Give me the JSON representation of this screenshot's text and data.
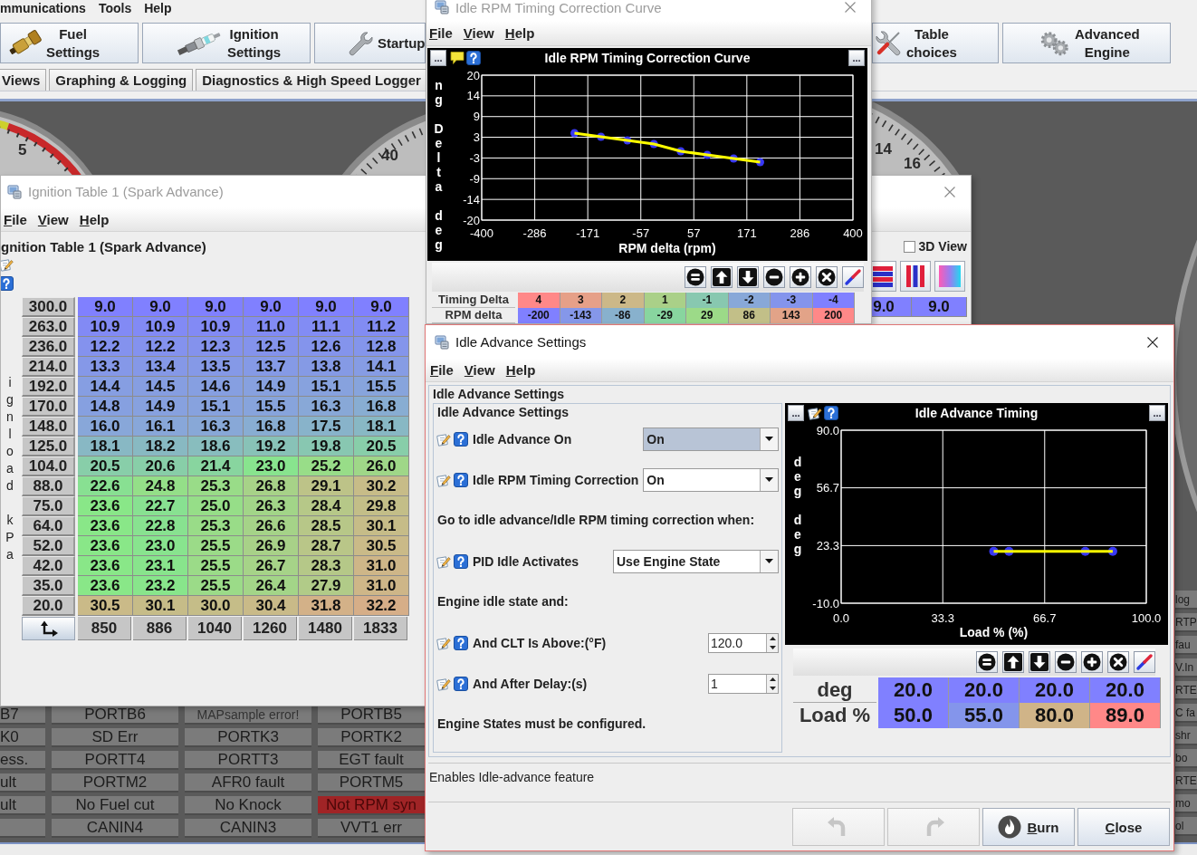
{
  "main_window": {
    "menu": [
      "mmunications",
      "Tools",
      "Help"
    ],
    "toolbar_left": [
      {
        "lines": [
          "Fuel",
          "Settings"
        ]
      },
      {
        "lines": [
          "Ignition",
          "Settings"
        ]
      },
      {
        "lines": [
          "Startup"
        ]
      }
    ],
    "toolbar_right": [
      {
        "lines": [
          "Table",
          "choices"
        ]
      },
      {
        "lines": [
          "Advanced",
          "Engine"
        ]
      }
    ],
    "tabs": [
      {
        "label": "Views",
        "selected": false
      },
      {
        "label": "Graphing & Logging",
        "selected": false
      },
      {
        "label": "Diagnostics & High Speed Logger",
        "selected": false
      }
    ],
    "dashboard": {
      "gauge_labels": [
        "5",
        "40",
        "14",
        "16"
      ],
      "indicator_columns": [
        [
          {
            "label": "B7",
            "on": false
          },
          {
            "label": "K0",
            "on": false
          },
          {
            "label": "ess.",
            "on": false
          },
          {
            "label": "ult",
            "on": false
          },
          {
            "label": "ult",
            "on": false
          },
          {
            "on": false
          }
        ],
        [
          {
            "label": "PORTB6",
            "on": false
          },
          {
            "label": "SD Err",
            "on": false
          },
          {
            "label": "PORTT4",
            "on": false
          },
          {
            "label": "PORTM2",
            "on": false
          },
          {
            "label": "No Fuel cut",
            "on": false
          },
          {
            "label": "CANIN4",
            "on": false
          }
        ],
        [
          {
            "label": "MAPsample error!",
            "on": false
          },
          {
            "label": "PORTK3",
            "on": false
          },
          {
            "label": "PORTT3",
            "on": false
          },
          {
            "label": "AFR0 fault",
            "on": false
          },
          {
            "label": "No Knock",
            "on": false
          },
          {
            "label": "CANIN3",
            "on": false
          }
        ],
        [
          {
            "label": "PORTB5",
            "on": false
          },
          {
            "label": "PORTK2",
            "on": false
          },
          {
            "label": "EGT fault",
            "on": false
          },
          {
            "label": "PORTM5",
            "on": false
          },
          {
            "label": "Not RPM syn",
            "on": true
          },
          {
            "label": "VVT1 err",
            "on": false
          }
        ]
      ],
      "edge_indicators": [
        {
          "label": "log",
          "on": false
        },
        {
          "label": "RTP",
          "on": false
        },
        {
          "label": "fau",
          "on": false
        },
        {
          "label": "V.In",
          "on": false
        },
        {
          "label": "RTE",
          "on": false
        },
        {
          "label": "C fa",
          "on": false
        },
        {
          "label": "shr",
          "on": false
        },
        {
          "label": "bo",
          "on": false
        },
        {
          "label": "RTE",
          "on": false
        },
        {
          "label": "mo",
          "on": false
        },
        {
          "label": "ol",
          "on": false
        }
      ]
    }
  },
  "ignition_window": {
    "title": "Ignition Table 1 (Spark Advance)",
    "active": false,
    "menu": [
      "File",
      "View",
      "Help"
    ],
    "heading": "gnition Table 1 (Spark Advance)",
    "view_3d": {
      "label": "3D View",
      "checked": false
    },
    "y_axis_label": "ignload kPa",
    "rows": [
      {
        "load": "300.0",
        "cells": [
          "9.0",
          "9.0",
          "9.0",
          "9.0",
          "9.0",
          "9.0"
        ]
      },
      {
        "load": "263.0",
        "cells": [
          "10.9",
          "10.9",
          "10.9",
          "11.0",
          "11.1",
          "11.2"
        ]
      },
      {
        "load": "236.0",
        "cells": [
          "12.2",
          "12.2",
          "12.3",
          "12.5",
          "12.6",
          "12.8"
        ]
      },
      {
        "load": "214.0",
        "cells": [
          "13.3",
          "13.4",
          "13.5",
          "13.7",
          "13.8",
          "14.1"
        ]
      },
      {
        "load": "192.0",
        "cells": [
          "14.4",
          "14.5",
          "14.6",
          "14.9",
          "15.1",
          "15.5"
        ]
      },
      {
        "load": "170.0",
        "cells": [
          "14.8",
          "14.9",
          "15.1",
          "15.5",
          "16.3",
          "16.8"
        ]
      },
      {
        "load": "148.0",
        "cells": [
          "16.0",
          "16.1",
          "16.3",
          "16.8",
          "17.5",
          "18.1"
        ]
      },
      {
        "load": "125.0",
        "cells": [
          "18.1",
          "18.2",
          "18.6",
          "19.2",
          "19.8",
          "20.5"
        ]
      },
      {
        "load": "104.0",
        "cells": [
          "20.5",
          "20.6",
          "21.4",
          "23.0",
          "25.2",
          "26.0"
        ]
      },
      {
        "load": "88.0",
        "cells": [
          "22.6",
          "24.8",
          "25.3",
          "26.8",
          "29.1",
          "30.2"
        ]
      },
      {
        "load": "75.0",
        "cells": [
          "23.6",
          "22.7",
          "25.0",
          "26.3",
          "28.4",
          "29.8"
        ]
      },
      {
        "load": "64.0",
        "cells": [
          "23.6",
          "22.8",
          "25.3",
          "26.6",
          "28.5",
          "30.1"
        ]
      },
      {
        "load": "52.0",
        "cells": [
          "23.6",
          "23.0",
          "25.5",
          "26.9",
          "28.7",
          "30.5"
        ]
      },
      {
        "load": "42.0",
        "cells": [
          "23.6",
          "23.1",
          "25.5",
          "26.7",
          "28.3",
          "31.0"
        ]
      },
      {
        "load": "35.0",
        "cells": [
          "23.6",
          "23.2",
          "25.5",
          "26.4",
          "27.9",
          "31.0"
        ]
      },
      {
        "load": "20.0",
        "cells": [
          "30.5",
          "30.1",
          "30.0",
          "30.4",
          "31.8",
          "32.2"
        ]
      }
    ],
    "x_axis": [
      "850",
      "886",
      "1040",
      "1260",
      "1480",
      "1833"
    ],
    "right_cells": [
      "9.0",
      "9.0"
    ]
  },
  "curve_window": {
    "title": "Idle RPM Timing Correction Curve",
    "active": false,
    "menu": [
      "File",
      "View",
      "Help"
    ],
    "chart_menu_buttons": [
      "...",
      "..."
    ],
    "chart_data": {
      "type": "line",
      "title": "Idle RPM Timing Correction Curve",
      "xlabel": "RPM delta (rpm)",
      "ylabel": "ng Delta deg",
      "grid": true,
      "x": [
        -200,
        -143,
        -86,
        -29,
        29,
        86,
        143,
        200
      ],
      "series": [
        {
          "color": "#ffff00",
          "marker": "circle",
          "values": [
            4,
            3,
            2,
            1,
            -1,
            -2,
            -3,
            -4
          ]
        }
      ],
      "xlim": [
        -400,
        400
      ],
      "ylim": [
        -20,
        20
      ],
      "xticks": [
        {
          "value": -400,
          "label": "-400"
        },
        {
          "value": -285.7,
          "label": "-286"
        },
        {
          "value": -171.4,
          "label": "-171"
        },
        {
          "value": -57.1,
          "label": "-57"
        },
        {
          "value": 57.1,
          "label": "57"
        },
        {
          "value": 171.4,
          "label": "171"
        },
        {
          "value": 285.7,
          "label": "286"
        },
        {
          "value": 400,
          "label": "400"
        }
      ],
      "yticks": [
        {
          "value": 20,
          "label": "20"
        },
        {
          "value": 14.29,
          "label": "14"
        },
        {
          "value": 8.57,
          "label": "9"
        },
        {
          "value": 2.86,
          "label": "3"
        },
        {
          "value": -2.86,
          "label": "-3"
        },
        {
          "value": -8.57,
          "label": "-9"
        },
        {
          "value": -14.29,
          "label": "-14"
        },
        {
          "value": -20,
          "label": "-20"
        }
      ]
    },
    "table": [
      {
        "label": "Timing Delta",
        "values": [
          "4",
          "3",
          "2",
          "1",
          "-1",
          "-2",
          "-3",
          "-4"
        ]
      },
      {
        "label": "RPM delta",
        "values": [
          "-200",
          "-143",
          "-86",
          "-29",
          "29",
          "86",
          "143",
          "200"
        ]
      }
    ]
  },
  "settings_window": {
    "title": "Idle Advance Settings",
    "active": true,
    "menu": [
      "File",
      "View",
      "Help"
    ],
    "group_title": "Idle Advance Settings",
    "subgroup_title": "Idle Advance Settings",
    "rows": [
      {
        "kind": "select",
        "label": "Idle Advance On",
        "value": "On",
        "focused": true
      },
      {
        "kind": "select",
        "label": "Idle RPM Timing Correction",
        "value": "On",
        "focused": false
      },
      {
        "kind": "note",
        "label": "Go to idle advance/Idle RPM timing correction when:"
      },
      {
        "kind": "select",
        "label": "PID Idle Activates",
        "value": "Use Engine State",
        "focused": false
      },
      {
        "kind": "note",
        "label": "Engine idle state and:"
      },
      {
        "kind": "spinner",
        "label": "And CLT Is Above:(°F)",
        "value": "120.0"
      },
      {
        "kind": "spinner",
        "label": "And After Delay:(s)",
        "value": "1"
      },
      {
        "kind": "note",
        "label": "Engine States must be configured."
      }
    ],
    "chart_menu_buttons": [
      "...",
      "..."
    ],
    "chart_data": {
      "type": "line",
      "title": "Idle Advance Timing",
      "xlabel": "Load % (%)",
      "ylabel": "deg deg",
      "grid": true,
      "x": [
        50,
        55,
        80,
        89
      ],
      "series": [
        {
          "color": "#ffff00",
          "marker": "circle",
          "values": [
            20,
            20,
            20,
            20
          ]
        }
      ],
      "xlim": [
        0,
        100
      ],
      "ylim": [
        -10,
        90
      ],
      "xticks": [
        {
          "value": 0,
          "label": "0.0"
        },
        {
          "value": 33.3,
          "label": "33.3"
        },
        {
          "value": 66.7,
          "label": "66.7"
        },
        {
          "value": 100,
          "label": "100.0"
        }
      ],
      "yticks": [
        {
          "value": 90,
          "label": "90.0"
        },
        {
          "value": 56.7,
          "label": "56.7"
        },
        {
          "value": 23.3,
          "label": "23.3"
        },
        {
          "value": -10,
          "label": "-10.0"
        }
      ]
    },
    "table": [
      {
        "label": "deg",
        "values": [
          "20.0",
          "20.0",
          "20.0",
          "20.0"
        ]
      },
      {
        "label": "Load %",
        "values": [
          "50.0",
          "55.0",
          "80.0",
          "89.0"
        ]
      }
    ],
    "status": "Enables Idle-advance feature",
    "buttons": [
      {
        "kind": "undo",
        "disabled": true
      },
      {
        "kind": "redo",
        "disabled": true
      },
      {
        "kind": "burn",
        "label": "Burn",
        "disabled": false
      },
      {
        "kind": "close",
        "label": "Close",
        "disabled": false
      }
    ]
  }
}
